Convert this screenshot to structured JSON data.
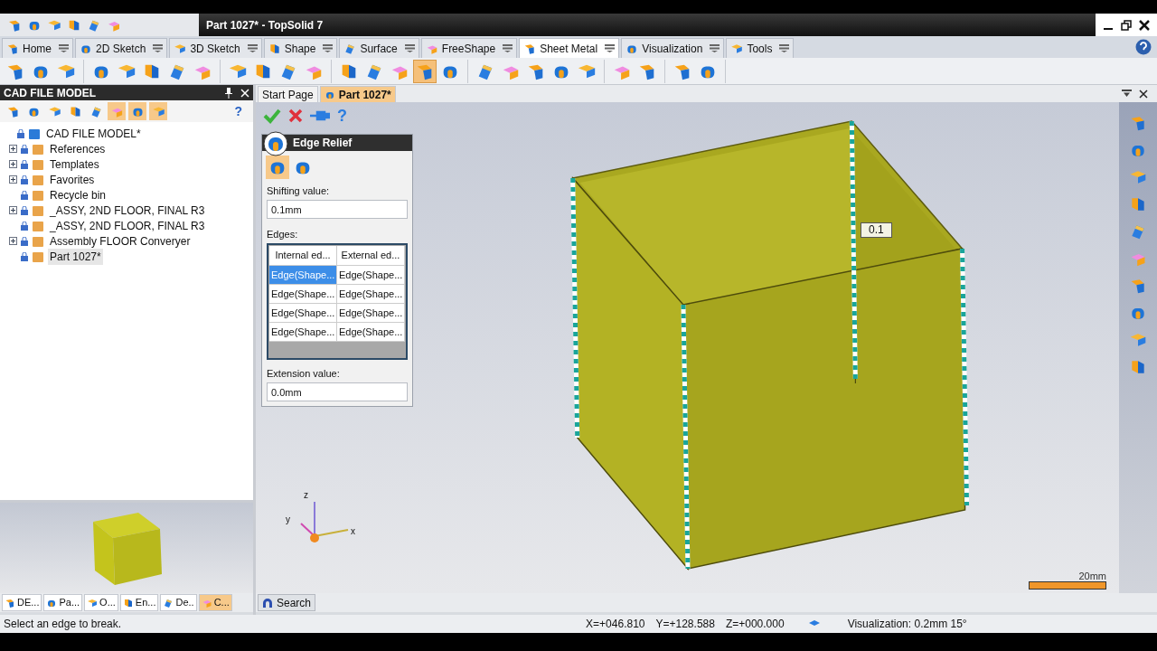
{
  "window": {
    "title": "Part 1027* - TopSolid 7"
  },
  "ribbon_tabs": [
    {
      "label": "Home",
      "selected": false
    },
    {
      "label": "2D Sketch",
      "selected": false
    },
    {
      "label": "3D Sketch",
      "selected": false
    },
    {
      "label": "Shape",
      "selected": false
    },
    {
      "label": "Surface",
      "selected": false
    },
    {
      "label": "FreeShape",
      "selected": false
    },
    {
      "label": "Sheet Metal",
      "selected": true
    },
    {
      "label": "Visualization",
      "selected": false
    },
    {
      "label": "Tools",
      "selected": false
    }
  ],
  "cad_file_model": {
    "title": "CAD FILE MODEL",
    "help": "?",
    "tree": [
      {
        "label": "CAD FILE MODEL*",
        "collapsed": false,
        "selected": false,
        "children": [
          {
            "label": "References",
            "collapsed": true,
            "selected": false
          },
          {
            "label": "Templates",
            "collapsed": true,
            "selected": false
          },
          {
            "label": "Favorites",
            "collapsed": true,
            "selected": false
          },
          {
            "label": "Recycle bin",
            "collapsed": false,
            "selected": false
          },
          {
            "label": "_ASSY, 2ND FLOOR, FINAL R3",
            "collapsed": true,
            "selected": false
          },
          {
            "label": "_ASSY, 2ND FLOOR, FINAL R3",
            "collapsed": false,
            "selected": false
          },
          {
            "label": "Assembly FLOOR Converyer",
            "collapsed": true,
            "selected": false
          },
          {
            "label": "Part 1027*",
            "collapsed": false,
            "selected": true
          }
        ]
      }
    ]
  },
  "document_tabs": [
    {
      "label": "Start Page",
      "selected": false
    },
    {
      "label": "Part 1027*",
      "selected": true
    }
  ],
  "edge_relief": {
    "help": "?",
    "title": "Edge Relief",
    "modes": [
      {
        "selected": true
      },
      {
        "selected": false
      }
    ],
    "shifting_label": "Shifting value:",
    "shifting_value": "0.1mm",
    "edges_label": "Edges:",
    "columns": [
      "Internal ed...",
      "External ed..."
    ],
    "rows": [
      {
        "cells": [
          {
            "text": "Edge(Shape...",
            "selected": true
          },
          {
            "text": "Edge(Shape...",
            "selected": false
          }
        ]
      },
      {
        "cells": [
          {
            "text": "Edge(Shape...",
            "selected": false
          },
          {
            "text": "Edge(Shape...",
            "selected": false
          }
        ]
      },
      {
        "cells": [
          {
            "text": "Edge(Shape...",
            "selected": false
          },
          {
            "text": "Edge(Shape...",
            "selected": false
          }
        ]
      },
      {
        "cells": [
          {
            "text": "Edge(Shape...",
            "selected": false
          },
          {
            "text": "Edge(Shape...",
            "selected": false
          }
        ]
      }
    ],
    "extension_label": "Extension value:",
    "extension_value": "0.0mm"
  },
  "viewport": {
    "dimension": "0.1",
    "axis_labels": [
      "z",
      "y",
      "x"
    ],
    "scale": "20mm"
  },
  "bottom_tabs": [
    {
      "label": "DE...",
      "selected": false
    },
    {
      "label": "Pa...",
      "selected": false
    },
    {
      "label": "O...",
      "selected": false
    },
    {
      "label": "En...",
      "selected": false
    },
    {
      "label": "De..",
      "selected": false
    },
    {
      "label": "C...",
      "selected": true
    }
  ],
  "search_tab": {
    "label": "Search"
  },
  "status_bar": {
    "message": "Select an edge to break.",
    "x": "X=+046.810",
    "y": "Y=+128.588",
    "z": "Z=+000.000",
    "visualization": "Visualization: 0.2mm 15°"
  }
}
